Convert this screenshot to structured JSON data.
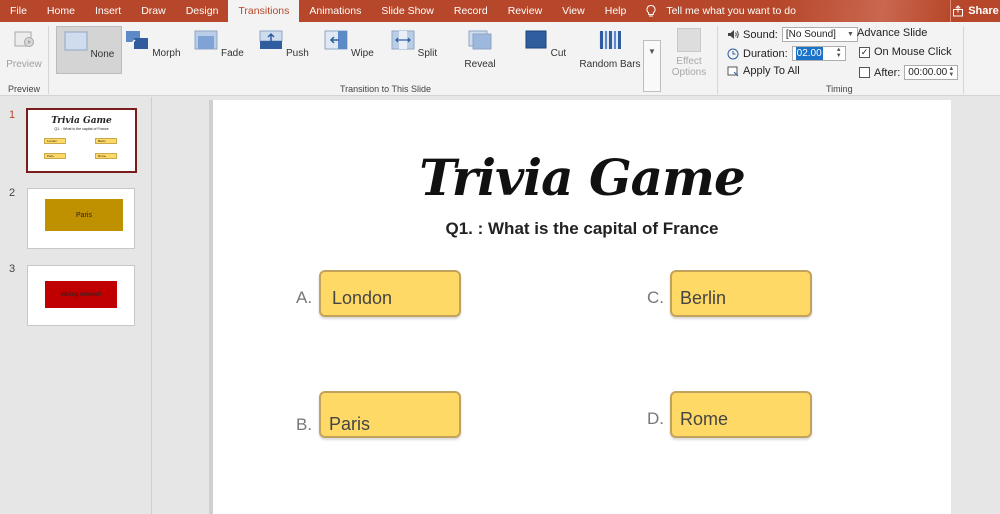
{
  "tabs": [
    "File",
    "Home",
    "Insert",
    "Draw",
    "Design",
    "Transitions",
    "Animations",
    "Slide Show",
    "Record",
    "Review",
    "View",
    "Help"
  ],
  "active_tab": "Transitions",
  "tell_me": "Tell me what you want to do",
  "share_label": "Share",
  "ribbon": {
    "preview_label": "Preview",
    "preview_group": "Preview",
    "transitions": [
      "None",
      "Morph",
      "Fade",
      "Push",
      "Wipe",
      "Split",
      "Reveal",
      "Cut",
      "Random Bars"
    ],
    "effect_options": "Effect Options",
    "transition_group": "Transition to This Slide",
    "sound_label": "Sound:",
    "sound_value": "[No Sound]",
    "duration_label": "Duration:",
    "duration_value": "02.00",
    "apply_all": "Apply To All",
    "advance_slide": "Advance Slide",
    "on_mouse_click": "On Mouse Click",
    "on_mouse_click_checked": true,
    "after_label": "After:",
    "after_value": "00:00.00",
    "after_checked": false,
    "timing_group": "Timing"
  },
  "thumbnails": [
    {
      "number": "1",
      "title": "Trivia Game",
      "question": "Q1. : What is the capital of France",
      "answers": [
        "London",
        "Berlin",
        "Paris",
        "Rome"
      ]
    },
    {
      "number": "2",
      "text": "Paris",
      "color": "#bf9000"
    },
    {
      "number": "3",
      "text": "Wrong Answer!",
      "color": "#c00000"
    }
  ],
  "slide": {
    "title": "Trivia Game",
    "question": "Q1. : What is the capital of France",
    "answers": [
      {
        "letter": "A.",
        "text": "London"
      },
      {
        "letter": "C.",
        "text": "Berlin"
      },
      {
        "letter": "B.",
        "text": "Paris"
      },
      {
        "letter": "D.",
        "text": "Rome"
      }
    ],
    "answer_fill": "#ffd966"
  }
}
